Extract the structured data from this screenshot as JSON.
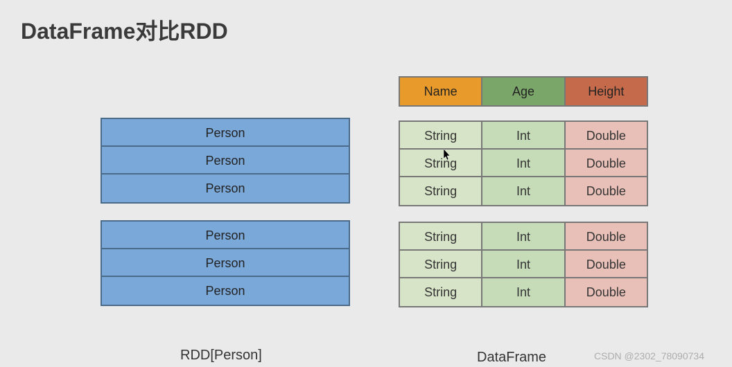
{
  "title": "DataFrame对比RDD",
  "rdd": {
    "block1": [
      "Person",
      "Person",
      "Person"
    ],
    "block2": [
      "Person",
      "Person",
      "Person"
    ],
    "caption": "RDD[Person]"
  },
  "dataframe": {
    "headers": {
      "name": "Name",
      "age": "Age",
      "height": "Height"
    },
    "block1": [
      {
        "name": "String",
        "age": "Int",
        "height": "Double"
      },
      {
        "name": "String",
        "age": "Int",
        "height": "Double"
      },
      {
        "name": "String",
        "age": "Int",
        "height": "Double"
      }
    ],
    "block2": [
      {
        "name": "String",
        "age": "Int",
        "height": "Double"
      },
      {
        "name": "String",
        "age": "Int",
        "height": "Double"
      },
      {
        "name": "String",
        "age": "Int",
        "height": "Double"
      }
    ],
    "caption": "DataFrame"
  },
  "watermark": "CSDN @2302_78090734"
}
